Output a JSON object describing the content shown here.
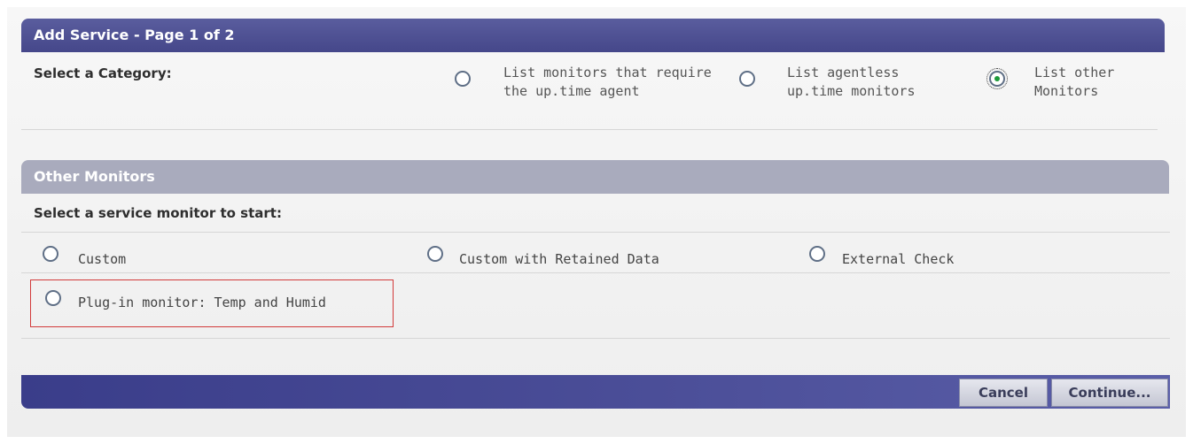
{
  "panel": {
    "title": "Add Service - Page 1 of 2",
    "category_label": "Select a Category:",
    "categories": [
      {
        "label": "List monitors that require the up.time agent",
        "checked": false
      },
      {
        "label": "List agentless up.time monitors",
        "checked": false
      },
      {
        "label": "List other Monitors",
        "checked": true
      }
    ]
  },
  "other_monitors": {
    "title": "Other Monitors",
    "select_label": "Select a service monitor to start:",
    "services": [
      {
        "label": "Custom"
      },
      {
        "label": "Custom with Retained Data"
      },
      {
        "label": "External Check"
      },
      {
        "label": "Plug-in monitor: Temp and Humid"
      }
    ]
  },
  "footer": {
    "cancel_label": "Cancel",
    "continue_label": "Continue..."
  },
  "colors": {
    "header": "#45478a",
    "subheader": "#a9abbd",
    "highlight": "#d23a3a",
    "selected_dot": "#1e9a3a"
  }
}
